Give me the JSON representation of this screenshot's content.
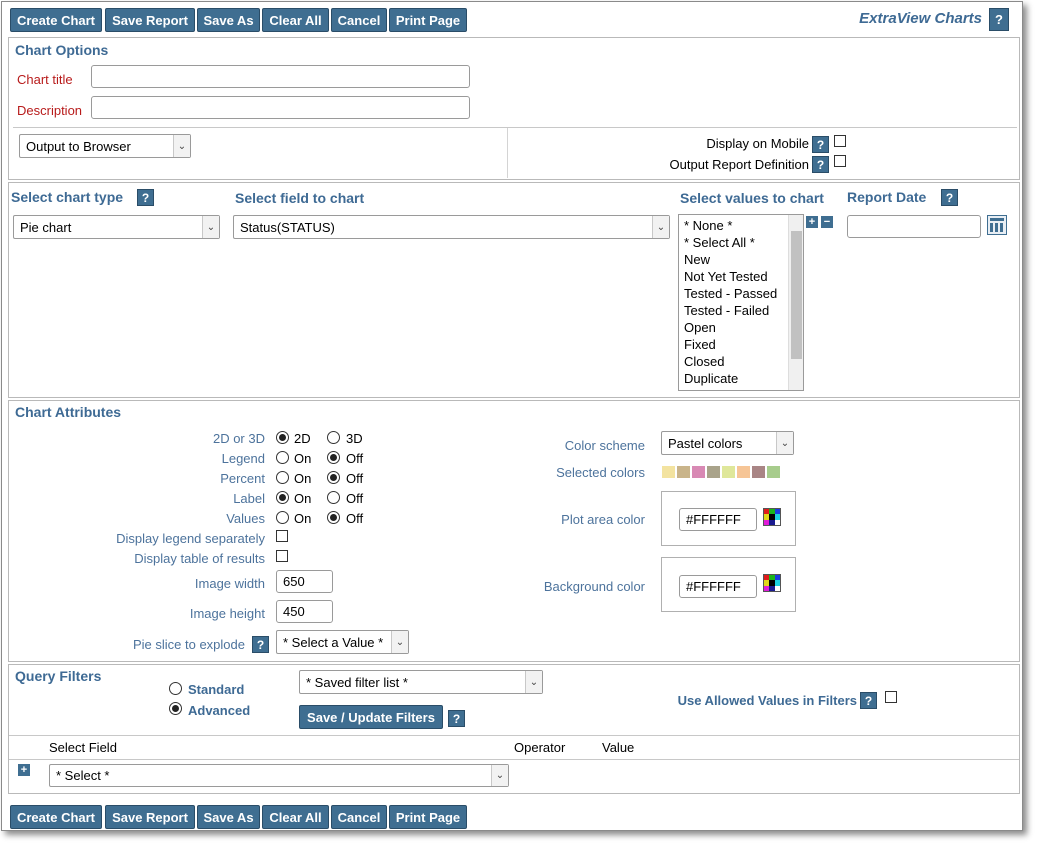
{
  "toolbar": {
    "create_chart": "Create Chart",
    "save_report": "Save Report",
    "save_as": "Save As",
    "clear_all": "Clear All",
    "cancel": "Cancel",
    "print_page": "Print Page"
  },
  "app_title": "ExtraView Charts",
  "help_glyph": "?",
  "chart_options": {
    "title": "Chart Options",
    "chart_title_label": "Chart title",
    "chart_title_value": "",
    "description_label": "Description",
    "description_value": "",
    "output_select": "Output to Browser",
    "display_on_mobile": "Display on Mobile",
    "output_report_definition": "Output Report Definition"
  },
  "chart_type": {
    "heading": "Select chart type",
    "selected": "Pie chart"
  },
  "field_to_chart": {
    "heading": "Select field to chart",
    "selected": "Status(STATUS)"
  },
  "values_to_chart": {
    "heading": "Select values to chart",
    "items": [
      "* None *",
      "* Select All *",
      "New",
      "Not Yet Tested",
      "Tested - Passed",
      "Tested - Failed",
      "Open",
      "Fixed",
      "Closed",
      "Duplicate"
    ]
  },
  "report_date": {
    "heading": "Report Date",
    "value": ""
  },
  "attributes": {
    "title": "Chart Attributes",
    "dim_label": "2D or 3D",
    "dim_2d": "2D",
    "dim_3d": "3D",
    "legend_label": "Legend",
    "percent_label": "Percent",
    "label_label": "Label",
    "values_label": "Values",
    "on": "On",
    "off": "Off",
    "legend_separately": "Display legend separately",
    "table_of_results": "Display table of results",
    "image_width_label": "Image width",
    "image_width": "650",
    "image_height_label": "Image height",
    "image_height": "450",
    "pie_slice_label": "Pie slice to explode",
    "pie_slice_value": "* Select a Value *",
    "color_scheme_label": "Color scheme",
    "color_scheme_value": "Pastel colors",
    "selected_colors_label": "Selected colors",
    "selected_colors": [
      "#f3e3a0",
      "#c9b48a",
      "#d889b4",
      "#a9a38a",
      "#dfe79a",
      "#f6c596",
      "#a98585",
      "#a7cc8c"
    ],
    "plot_area_label": "Plot area color",
    "plot_area_value": "#FFFFFF",
    "background_label": "Background color",
    "background_value": "#FFFFFF"
  },
  "query_filters": {
    "title": "Query Filters",
    "standard": "Standard",
    "advanced": "Advanced",
    "saved_filter": "* Saved filter list *",
    "save_update": "Save / Update Filters",
    "use_allowed": "Use Allowed Values in Filters",
    "col_select_field": "Select Field",
    "col_operator": "Operator",
    "col_value": "Value",
    "select_field_value": "* Select *"
  },
  "colors": {
    "accent": "#3f6e91",
    "section_title": "#3e6a94",
    "required_label": "#b81b1b",
    "field_label": "#4d739c"
  }
}
